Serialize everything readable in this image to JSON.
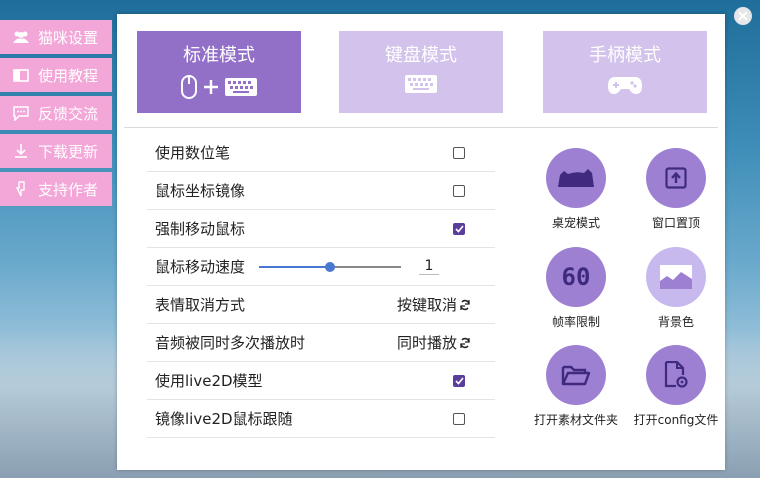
{
  "sidebar": {
    "items": [
      {
        "label": "猫咪设置",
        "icon": "users-icon"
      },
      {
        "label": "使用教程",
        "icon": "book-icon"
      },
      {
        "label": "反馈交流",
        "icon": "chat-icon"
      },
      {
        "label": "下载更新",
        "icon": "download-icon"
      },
      {
        "label": "支持作者",
        "icon": "support-icon"
      }
    ]
  },
  "modes": [
    {
      "label": "标准模式",
      "active": true
    },
    {
      "label": "键盘模式",
      "active": false
    },
    {
      "label": "手柄模式",
      "active": false
    }
  ],
  "options": {
    "digital_pen": {
      "label": "使用数位笔",
      "checked": false
    },
    "mirror_coords": {
      "label": "鼠标坐标镜像",
      "checked": false
    },
    "force_move": {
      "label": "强制移动鼠标",
      "checked": true
    },
    "move_speed": {
      "label": "鼠标移动速度",
      "value": "1",
      "slider_fraction": 0.5
    },
    "emote_cancel": {
      "label": "表情取消方式",
      "value": "按键取消"
    },
    "audio_multi": {
      "label": "音频被同时多次播放时",
      "value": "同时播放"
    },
    "use_live2d": {
      "label": "使用live2D模型",
      "checked": true
    },
    "mirror_live2d": {
      "label": "镜像live2D鼠标跟随",
      "checked": false
    }
  },
  "tools": [
    {
      "label": "桌宠模式",
      "icon": "cat-silhouette-icon"
    },
    {
      "label": "窗口置顶",
      "icon": "pin-top-icon"
    },
    {
      "label": "帧率限制",
      "icon": "fps-60-icon",
      "glyph": "60"
    },
    {
      "label": "背景色",
      "icon": "background-image-icon"
    },
    {
      "label": "打开素材文件夹",
      "icon": "folder-open-icon"
    },
    {
      "label": "打开config文件",
      "icon": "config-file-icon"
    }
  ],
  "colors": {
    "sidebar": "#f3a6d8",
    "mode_active": "#9370c8",
    "mode_inactive": "#d3c2ec",
    "tool_circle": "#9d80d2",
    "checkbox_on": "#5a3f9a",
    "slider": "#4a78d0"
  }
}
